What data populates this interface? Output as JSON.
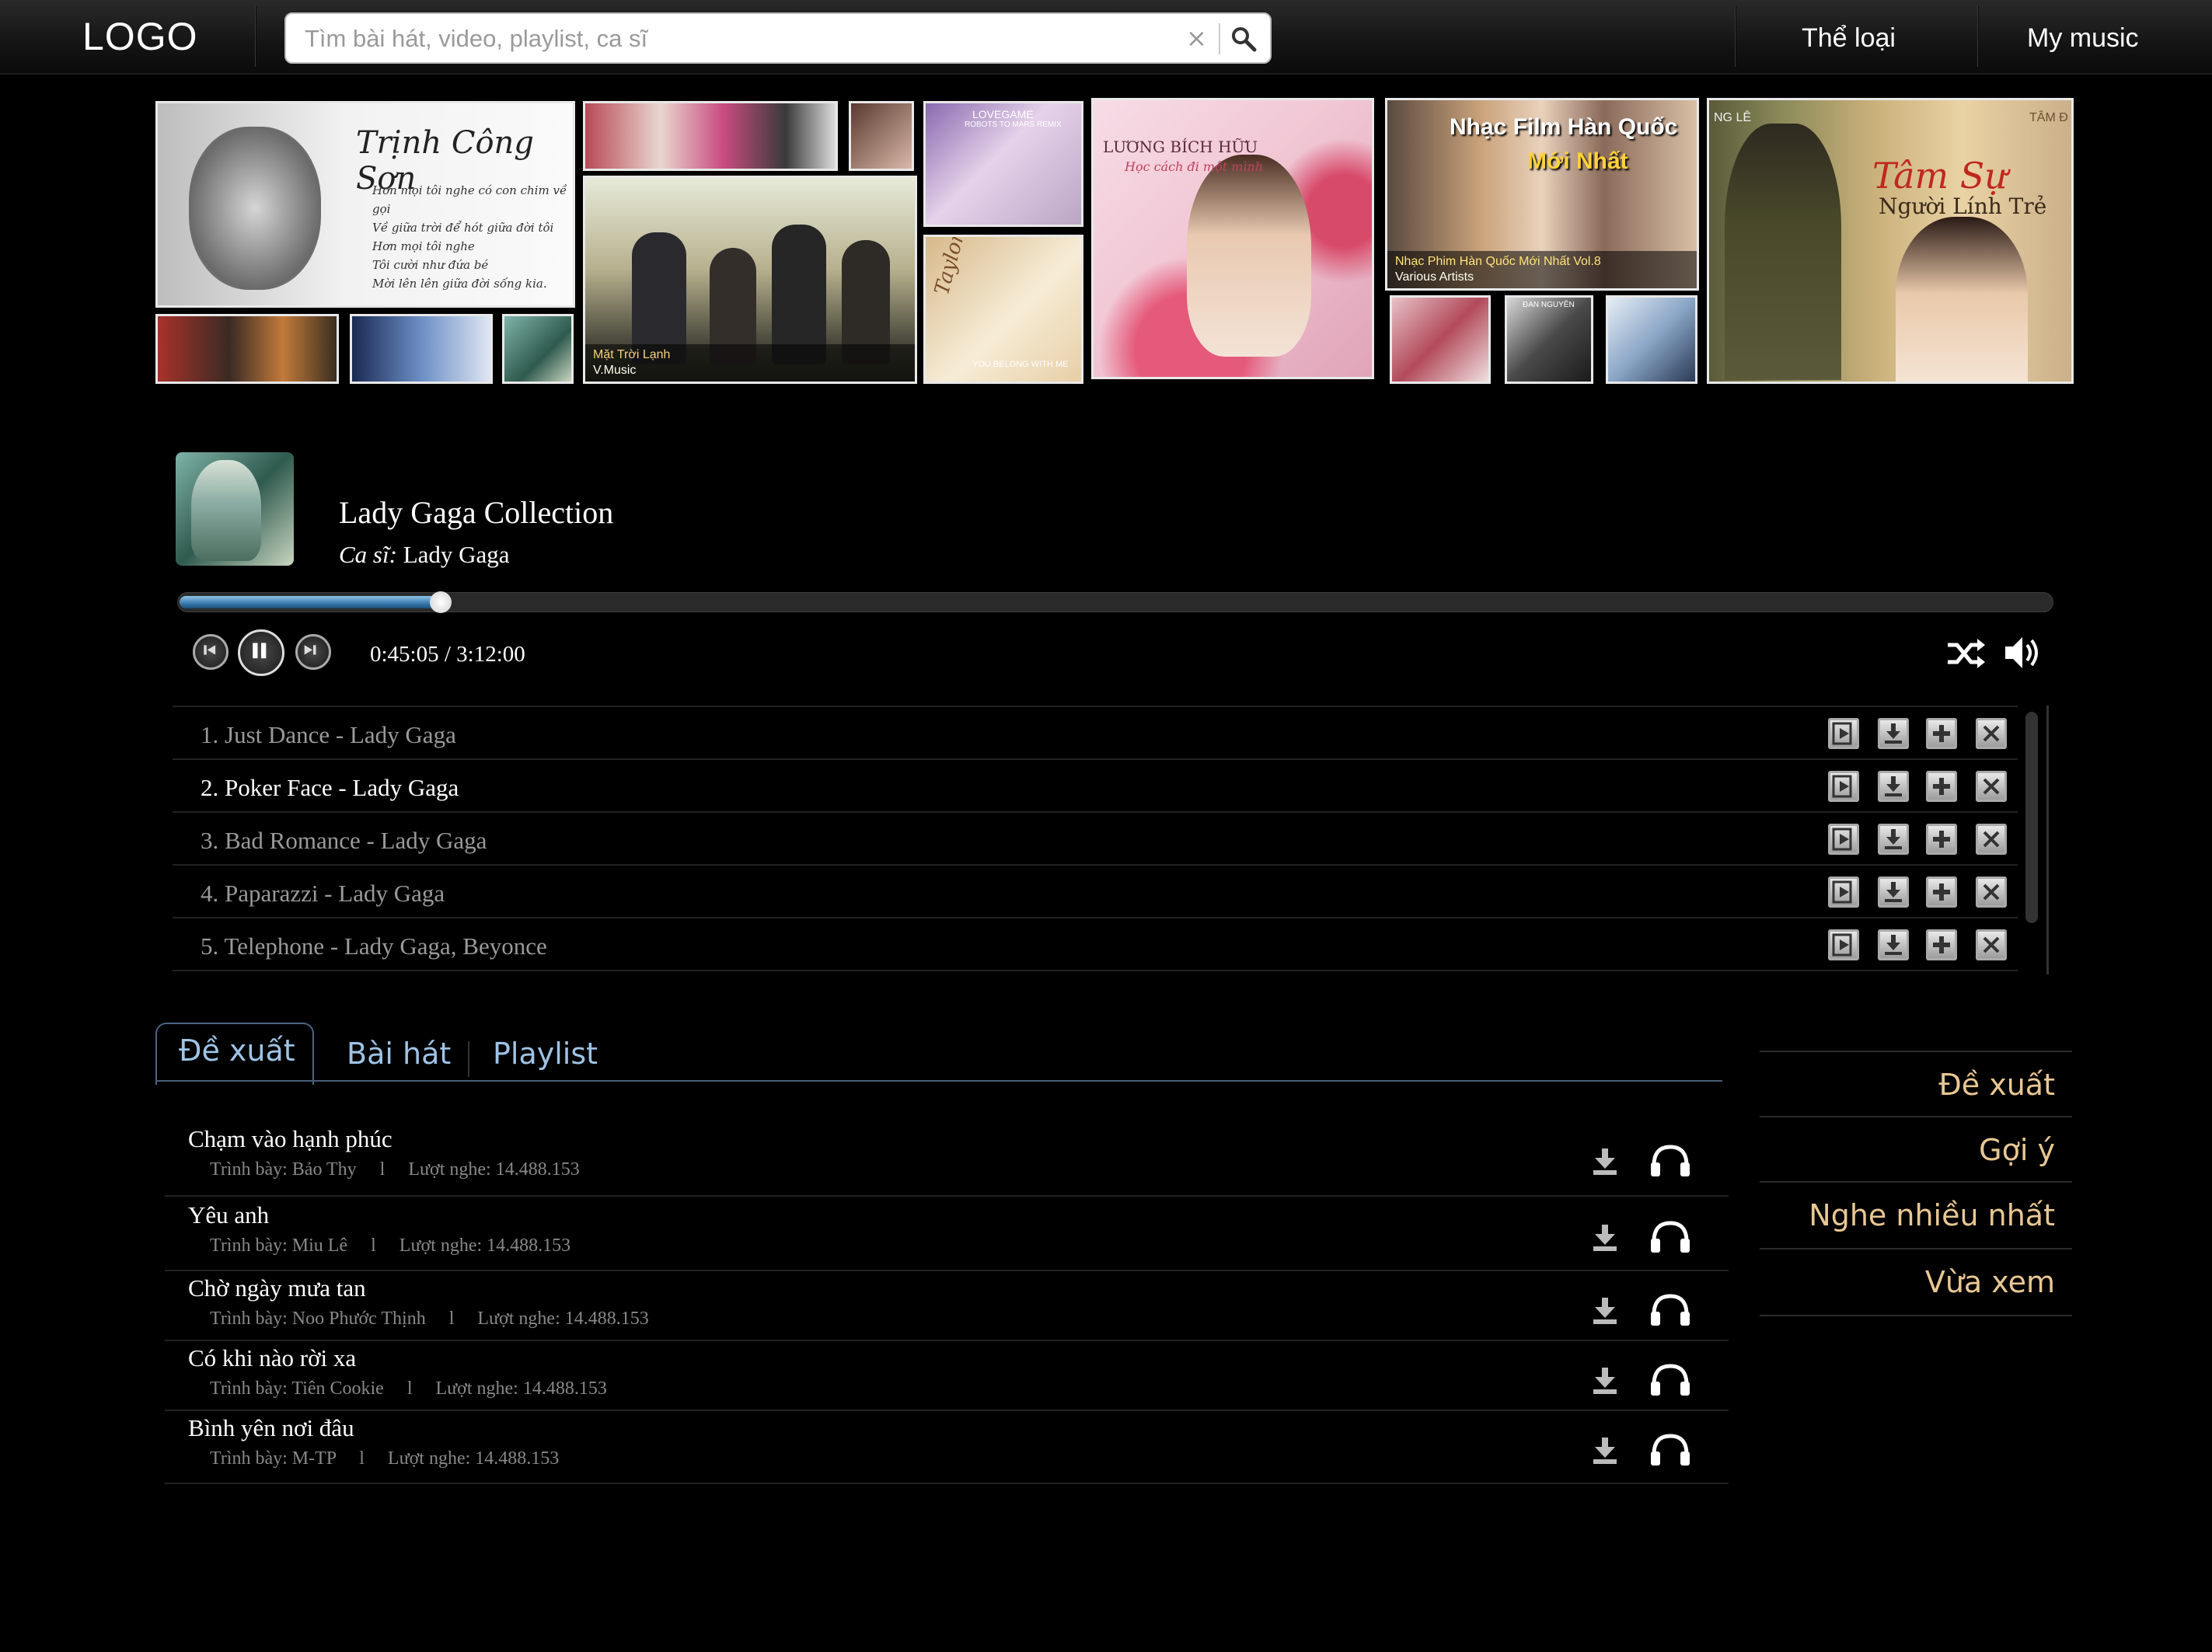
{
  "header": {
    "logo": "LOGO",
    "search_placeholder": "Tìm bài hát, video, playlist, ca sĩ",
    "clear_glyph": "×",
    "nav": [
      "Thể loại",
      "My music"
    ]
  },
  "banner": {
    "tiles": [
      {
        "title": "Trịnh Công Sơn",
        "lines": [
          "Hơn mọi tôi nghe có con chim về gọi",
          "Về giữa trời để hót giữa đời tôi",
          "Hơn mọi tôi nghe",
          "Tôi cười như đứa bé",
          "Mời lên lên giữa đời sống kia."
        ]
      },
      {
        "caption_title": "Mặt Trời Lạnh",
        "caption_sub": "V.Music"
      },
      {
        "top": "LOVEGAME",
        "sub": "ROBOTS TO MARS REMIX"
      },
      {
        "script": "Taylor Swift",
        "sub": "YOU BELONG WITH ME"
      },
      {
        "title": "LƯƠNG BÍCH HỮU",
        "sub": "Học cách đi một mình"
      },
      {
        "title": "Nhạc Film Hàn Quốc",
        "title2": "Mới Nhất",
        "caption_title": "Nhạc Phim Hàn Quốc Mới Nhất Vol.8",
        "caption_sub": "Various Artists"
      },
      {
        "small": "ĐAN NGUYÊN"
      },
      {
        "title": "Tâm Sự",
        "title2": "Người Lính Trẻ",
        "small": "TÂM Đ",
        "small2": "NG LÊ"
      }
    ]
  },
  "player": {
    "title": "Lady Gaga Collection",
    "artist_label": "Ca sĩ:",
    "artist": "Lady Gaga",
    "time": "0:45:05 / 3:12:00",
    "progress": 0.14
  },
  "playlist": [
    {
      "name": "1. Just Dance - Lady Gaga",
      "active": false
    },
    {
      "name": "2. Poker Face - Lady Gaga",
      "active": true
    },
    {
      "name": "3. Bad Romance - Lady Gaga",
      "active": false
    },
    {
      "name": "4. Paparazzi - Lady Gaga",
      "active": false
    },
    {
      "name": "5. Telephone - Lady Gaga, Beyonce",
      "active": false
    }
  ],
  "tabs": [
    "Đề xuất",
    "Bài hát",
    "Playlist"
  ],
  "songs": [
    {
      "title": "Chạm vào hạnh phúc",
      "meta": "Trình bày: Bảo Thy     l     Lượt nghe: 14.488.153"
    },
    {
      "title": "Yêu anh",
      "meta": "Trình bày: Miu Lê     l     Lượt nghe: 14.488.153"
    },
    {
      "title": "Chờ ngày mưa tan",
      "meta": "Trình bày: Noo Phước Thịnh     l     Lượt nghe: 14.488.153"
    },
    {
      "title": "Có khi nào rời xa",
      "meta": "Trình bày: Tiên Cookie     l     Lượt nghe: 14.488.153"
    },
    {
      "title": "Bình yên nơi đâu",
      "meta": "Trình bày: M-TP     l     Lượt nghe: 14.488.153"
    }
  ],
  "sidebar": [
    "Đề xuất",
    "Gợi ý",
    "Nghe nhiều nhất",
    "Vừa xem"
  ]
}
